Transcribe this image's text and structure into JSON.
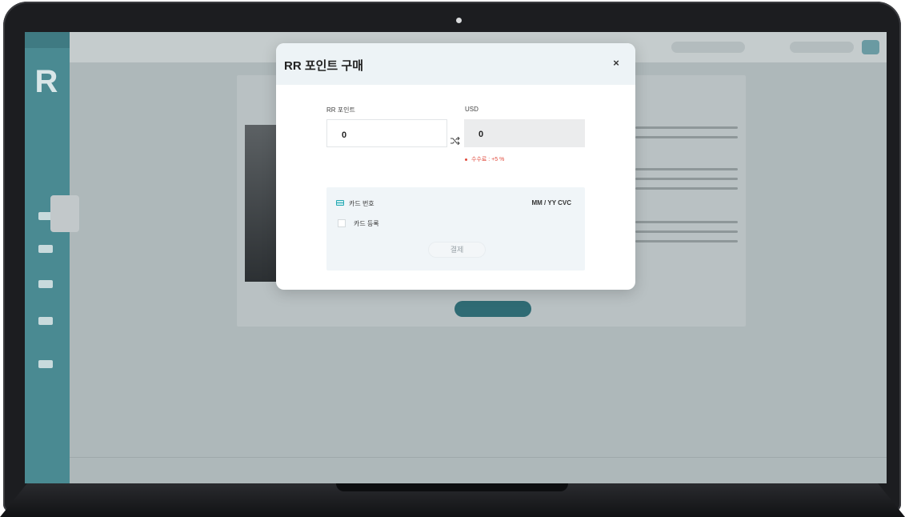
{
  "modal": {
    "title": "RR 포인트 구매",
    "close_label": "×",
    "rr_label": "RR 포인트",
    "rr_value": "0",
    "usd_label": "USD",
    "usd_value": "0",
    "fee_text": "수수료 : +5 %",
    "card": {
      "number_label": "카드 번호",
      "expiry_cvc_label": "MM / YY  CVC",
      "register_label": "카드 등록",
      "pay_label": "결제"
    }
  },
  "icons": {
    "swap": "shuffle-icon",
    "card": "credit-card-icon"
  },
  "colors": {
    "accent": "#27a9b4",
    "fee": "#e04a3c",
    "sidebar": "#4a8a92",
    "overlay": "#aeb8ba"
  }
}
